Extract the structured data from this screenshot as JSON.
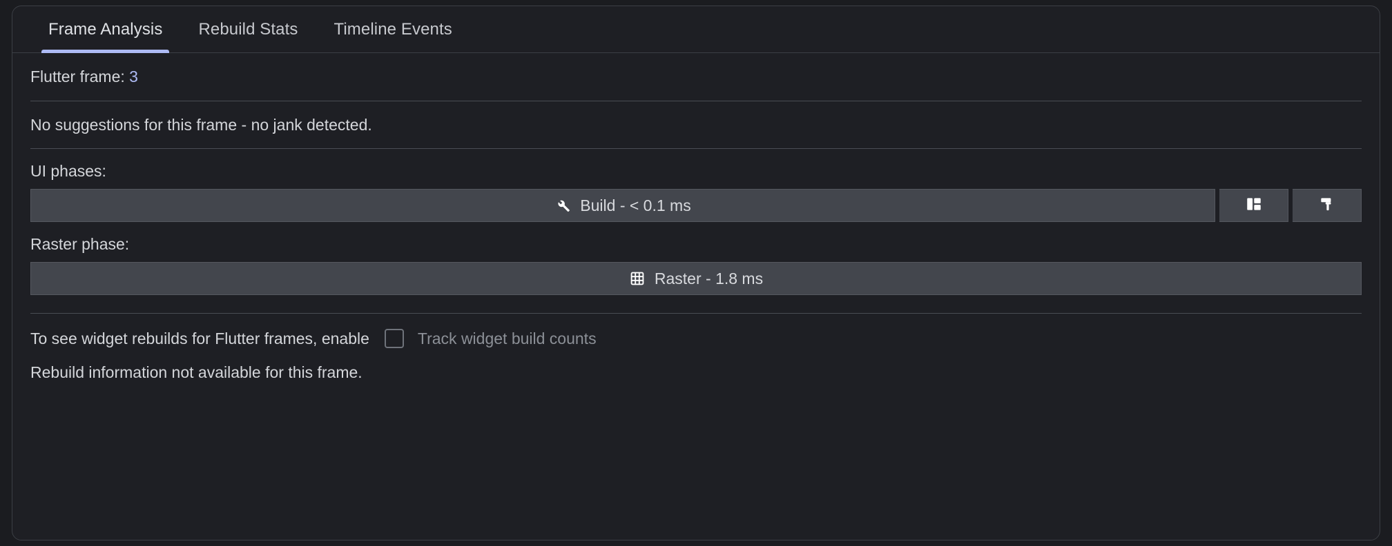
{
  "panel": {
    "tabs": [
      {
        "label": "Frame Analysis",
        "active": true
      },
      {
        "label": "Rebuild Stats",
        "active": false
      },
      {
        "label": "Timeline Events",
        "active": false
      }
    ],
    "frame": {
      "label": "Flutter frame: ",
      "number": "3"
    },
    "suggestions": "No suggestions for this frame - no jank detected.",
    "ui_phases": {
      "label": "UI phases:",
      "bar_label": "Build - < 0.1 ms",
      "bar_icon": "wrench-icon",
      "buttons": [
        {
          "icon": "split-layout-icon"
        },
        {
          "icon": "paint-roller-icon"
        }
      ]
    },
    "raster_phase": {
      "label": "Raster phase:",
      "bar_label": "Raster - 1.8 ms",
      "bar_icon": "grid-icon"
    },
    "rebuild": {
      "prefix": "To see widget rebuilds for Flutter frames, enable",
      "checkbox_label": "Track widget build counts",
      "checkbox_checked": false,
      "note": "Rebuild information not available for this frame."
    }
  },
  "colors": {
    "accent": "#aebbf5",
    "panel_bg": "#1e1f24",
    "page_bg": "#1b1c20",
    "bar_bg": "#43464d",
    "border": "#3c3f45",
    "text": "#d4d6da",
    "muted": "#8c9097"
  }
}
